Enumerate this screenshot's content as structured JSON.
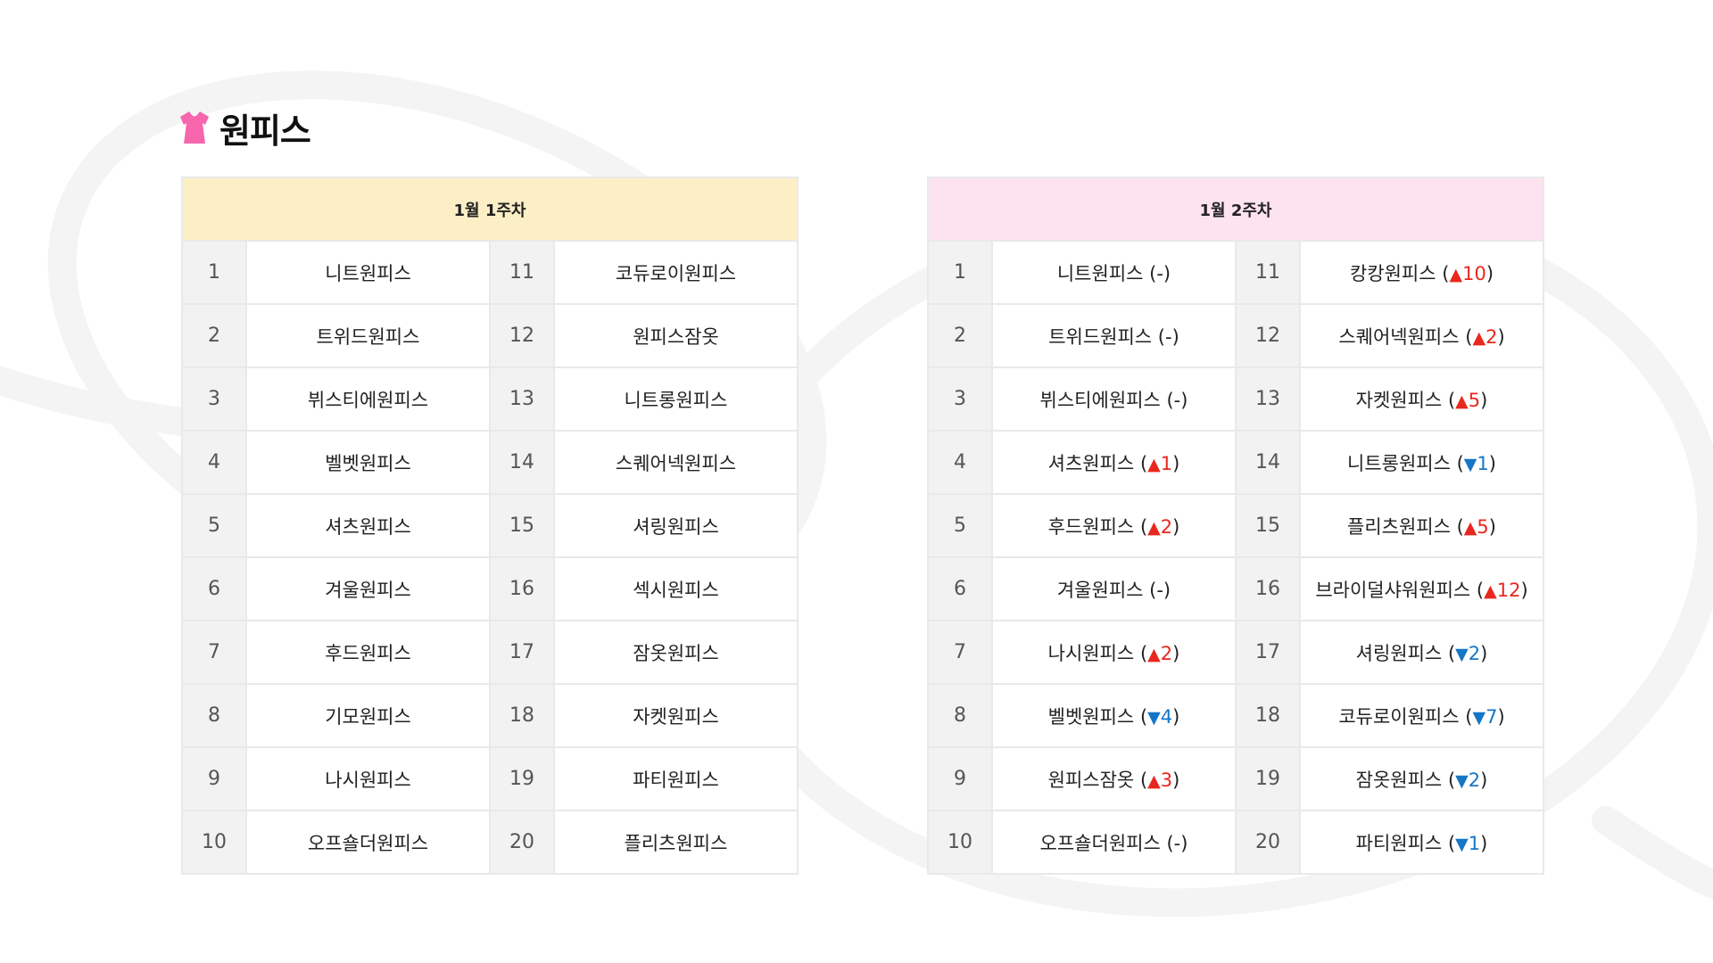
{
  "page": {
    "title": "원피스",
    "title_icon": "dress-icon",
    "icon_color": "#f766ad",
    "background_deco_color": "#f4f4f4"
  },
  "weeks": [
    {
      "label": "1월 1주차",
      "header_color": "#fdefc5",
      "rankings": [
        {
          "rank": "1",
          "item": "니트원피스"
        },
        {
          "rank": "2",
          "item": "트위드원피스"
        },
        {
          "rank": "3",
          "item": "뷔스티에원피스"
        },
        {
          "rank": "4",
          "item": "벨벳원피스"
        },
        {
          "rank": "5",
          "item": "셔츠원피스"
        },
        {
          "rank": "6",
          "item": "겨울원피스"
        },
        {
          "rank": "7",
          "item": "후드원피스"
        },
        {
          "rank": "8",
          "item": "기모원피스"
        },
        {
          "rank": "9",
          "item": "나시원피스"
        },
        {
          "rank": "10",
          "item": "오프숄더원피스"
        },
        {
          "rank": "11",
          "item": "코듀로이원피스"
        },
        {
          "rank": "12",
          "item": "원피스잠옷"
        },
        {
          "rank": "13",
          "item": "니트롱원피스"
        },
        {
          "rank": "14",
          "item": "스퀘어넥원피스"
        },
        {
          "rank": "15",
          "item": "셔링원피스"
        },
        {
          "rank": "16",
          "item": "섹시원피스"
        },
        {
          "rank": "17",
          "item": "잠옷원피스"
        },
        {
          "rank": "18",
          "item": "자켓원피스"
        },
        {
          "rank": "19",
          "item": "파티원피스"
        },
        {
          "rank": "20",
          "item": "플리츠원피스"
        }
      ]
    },
    {
      "label": "1월 2주차",
      "header_color": "#fde3ef",
      "rankings": [
        {
          "rank": "1",
          "item": "니트원피스",
          "change": "same"
        },
        {
          "rank": "2",
          "item": "트위드원피스",
          "change": "same"
        },
        {
          "rank": "3",
          "item": "뷔스티에원피스",
          "change": "same"
        },
        {
          "rank": "4",
          "item": "셔츠원피스",
          "change": "up",
          "delta": "1"
        },
        {
          "rank": "5",
          "item": "후드원피스",
          "change": "up",
          "delta": "2"
        },
        {
          "rank": "6",
          "item": "겨울원피스",
          "change": "same"
        },
        {
          "rank": "7",
          "item": "나시원피스",
          "change": "up",
          "delta": "2"
        },
        {
          "rank": "8",
          "item": "벨벳원피스",
          "change": "down",
          "delta": "4"
        },
        {
          "rank": "9",
          "item": "원피스잠옷",
          "change": "up",
          "delta": "3"
        },
        {
          "rank": "10",
          "item": "오프숄더원피스",
          "change": "same"
        },
        {
          "rank": "11",
          "item": "캉캉원피스",
          "change": "up",
          "delta": "10"
        },
        {
          "rank": "12",
          "item": "스퀘어넥원피스",
          "change": "up",
          "delta": "2"
        },
        {
          "rank": "13",
          "item": "자켓원피스",
          "change": "up",
          "delta": "5"
        },
        {
          "rank": "14",
          "item": "니트롱원피스",
          "change": "down",
          "delta": "1"
        },
        {
          "rank": "15",
          "item": "플리츠원피스",
          "change": "up",
          "delta": "5"
        },
        {
          "rank": "16",
          "item": "브라이덜샤워원피스",
          "change": "up",
          "delta": "12"
        },
        {
          "rank": "17",
          "item": "셔링원피스",
          "change": "down",
          "delta": "2"
        },
        {
          "rank": "18",
          "item": "코듀로이원피스",
          "change": "down",
          "delta": "7"
        },
        {
          "rank": "19",
          "item": "잠옷원피스",
          "change": "down",
          "delta": "2"
        },
        {
          "rank": "20",
          "item": "파티원피스",
          "change": "down",
          "delta": "1"
        }
      ]
    }
  ]
}
